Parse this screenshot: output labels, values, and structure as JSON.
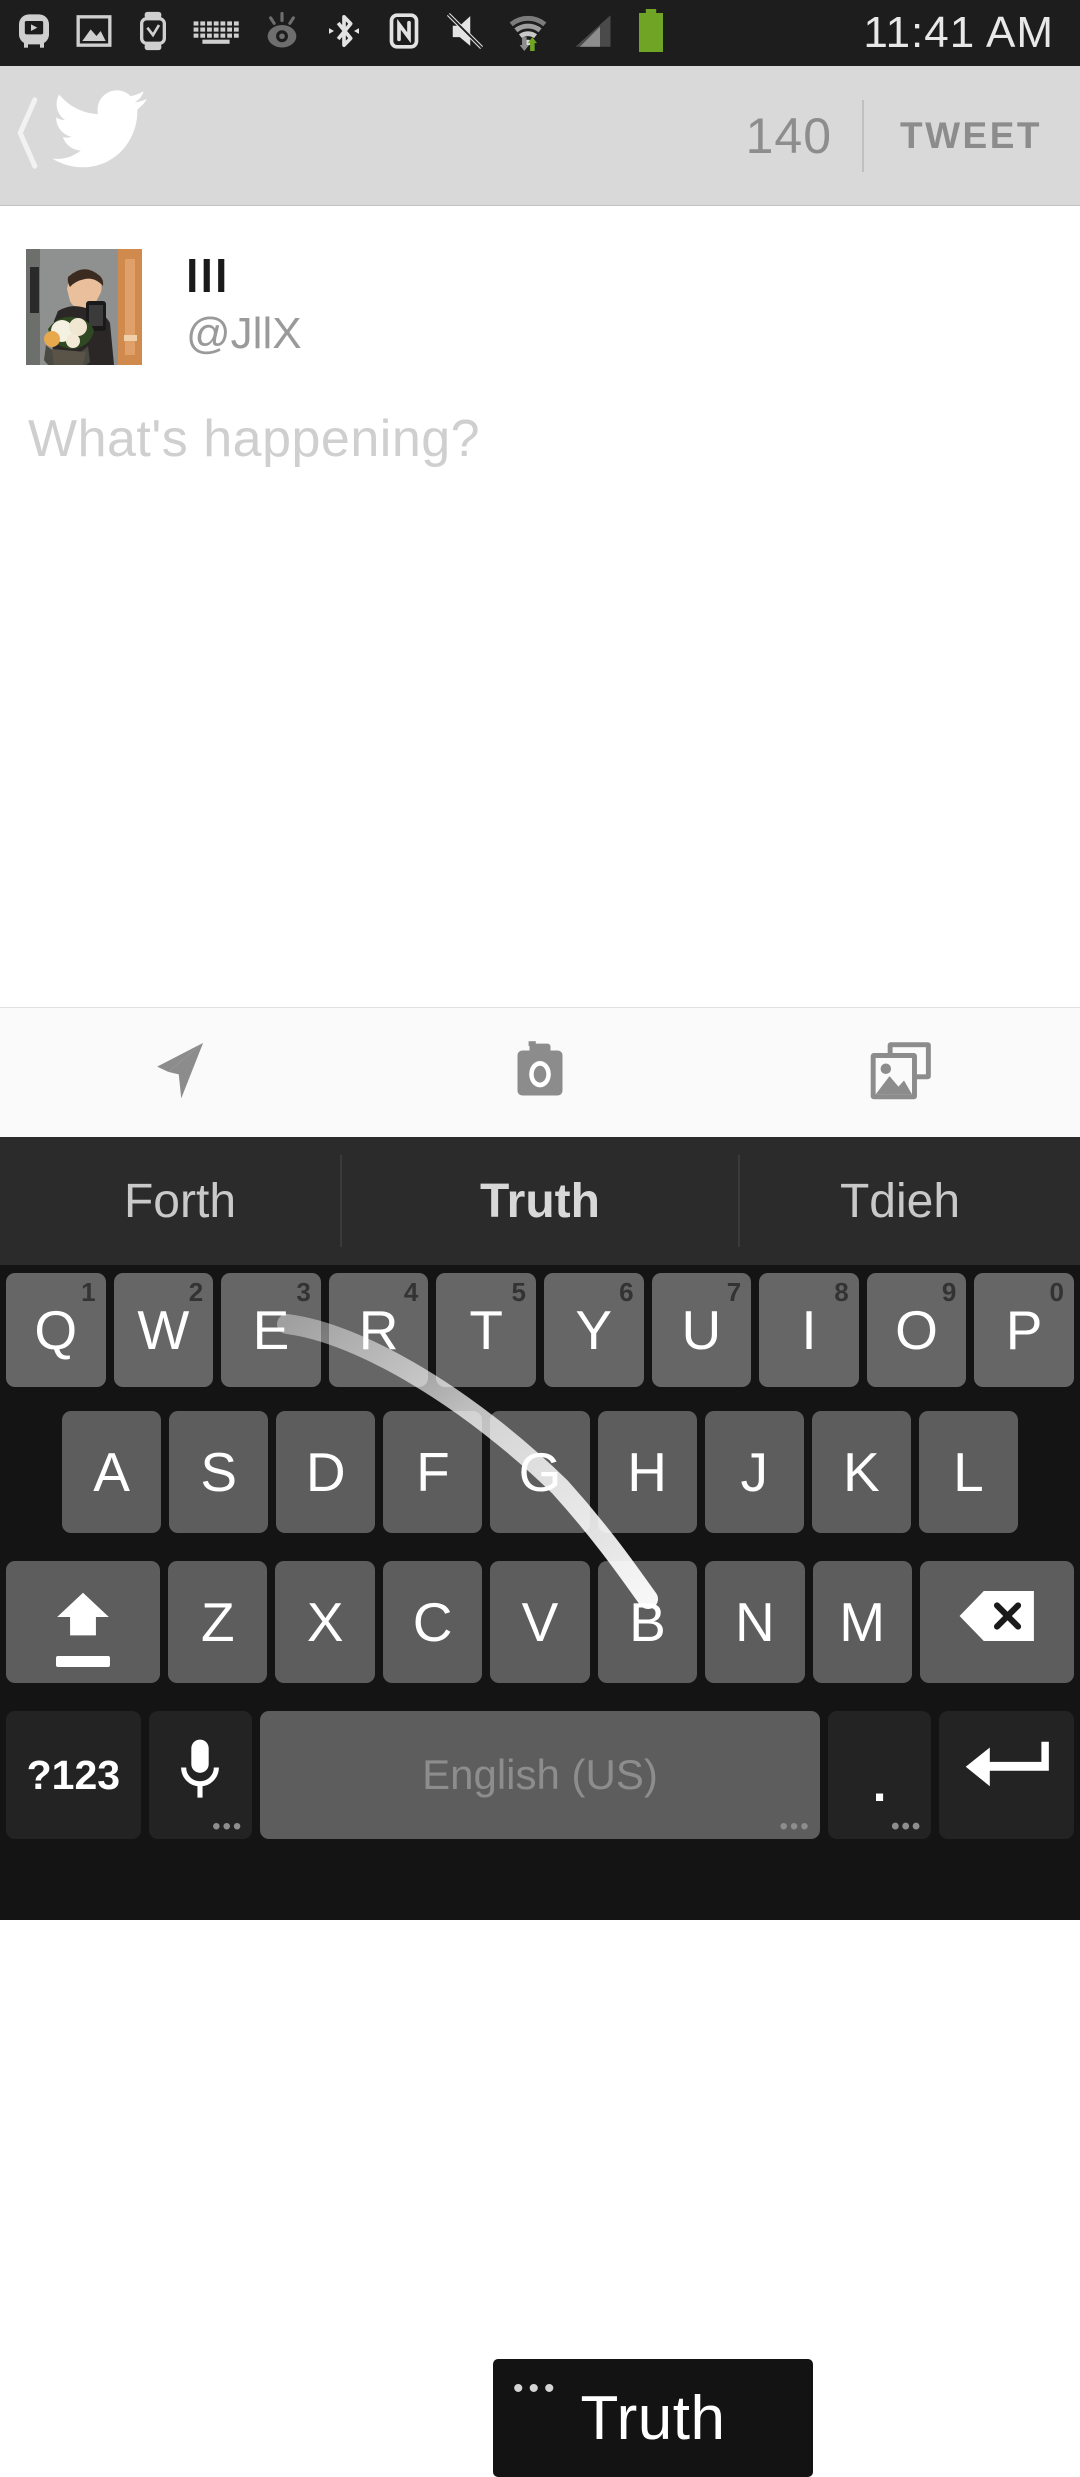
{
  "status_bar": {
    "time": "11:41 AM",
    "icons": [
      {
        "name": "screen-mirroring-icon"
      },
      {
        "name": "screenshot-icon"
      },
      {
        "name": "smartwatch-icon"
      },
      {
        "name": "keyboard-icon"
      },
      {
        "name": "smart-stay-eye-icon"
      },
      {
        "name": "bluetooth-icon"
      },
      {
        "name": "nfc-icon"
      },
      {
        "name": "volume-muted-icon"
      },
      {
        "name": "wifi-icon"
      },
      {
        "name": "cellular-signal-icon"
      },
      {
        "name": "battery-icon"
      }
    ],
    "background": "#1d1d1d",
    "battery_color": "#6fa424"
  },
  "header": {
    "back_label": "‹",
    "logo": "twitter-bird-icon",
    "char_count": "140",
    "tweet_label": "TWEET",
    "background": "#d9d9d9"
  },
  "compose": {
    "display_name": "lll",
    "handle": "@JllX",
    "placeholder": "What's happening?",
    "avatar_alt": "user-avatar"
  },
  "media_toolbar": {
    "items": [
      {
        "name": "location-icon",
        "label": "Location"
      },
      {
        "name": "camera-icon",
        "label": "Camera"
      },
      {
        "name": "gallery-icon",
        "label": "Gallery"
      }
    ]
  },
  "keyboard": {
    "suggestions": [
      {
        "text": "Forth",
        "selected": false
      },
      {
        "text": "Truth",
        "selected": true
      },
      {
        "text": "Tdieh",
        "selected": false
      }
    ],
    "popup_word": "Truth",
    "popup_ellipsis": "•••",
    "row1": [
      {
        "key": "Q",
        "num": "1"
      },
      {
        "key": "W",
        "num": "2"
      },
      {
        "key": "E",
        "num": "3"
      },
      {
        "key": "R",
        "num": "4"
      },
      {
        "key": "T",
        "num": "5"
      },
      {
        "key": "Y",
        "num": "6"
      },
      {
        "key": "U",
        "num": "7"
      },
      {
        "key": "I",
        "num": "8"
      },
      {
        "key": "O",
        "num": "9"
      },
      {
        "key": "P",
        "num": "0"
      }
    ],
    "row2": [
      "A",
      "S",
      "D",
      "F",
      "G",
      "H",
      "J",
      "K",
      "L"
    ],
    "row3": [
      "Z",
      "X",
      "C",
      "V",
      "B",
      "N",
      "M"
    ],
    "shift_name": "shift-key",
    "backspace_name": "backspace-key",
    "symbols_label": "?123",
    "space_label": "English (US)",
    "period_label": ".",
    "enter_name": "enter-key",
    "mic_name": "microphone-key",
    "long_press_dots": "•••",
    "background": "#141414",
    "key_color": "#5d5d5d",
    "func_key_color": "#2e2e2e"
  }
}
